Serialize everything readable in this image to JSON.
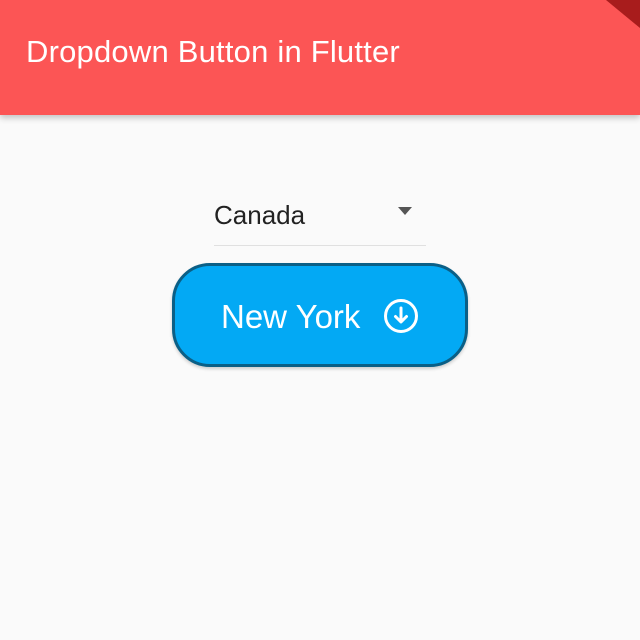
{
  "app_bar": {
    "title": "Dropdown Button in Flutter"
  },
  "dropdown": {
    "selected_value": "Canada",
    "icon": "arrow-drop-down-icon"
  },
  "city_button": {
    "label": "New York",
    "icon": "arrow-circle-down-icon"
  },
  "colors": {
    "app_bar": "#fc5555",
    "button_fill": "#03a9f4",
    "button_border": "#0b5f86",
    "background": "#fafafa"
  }
}
